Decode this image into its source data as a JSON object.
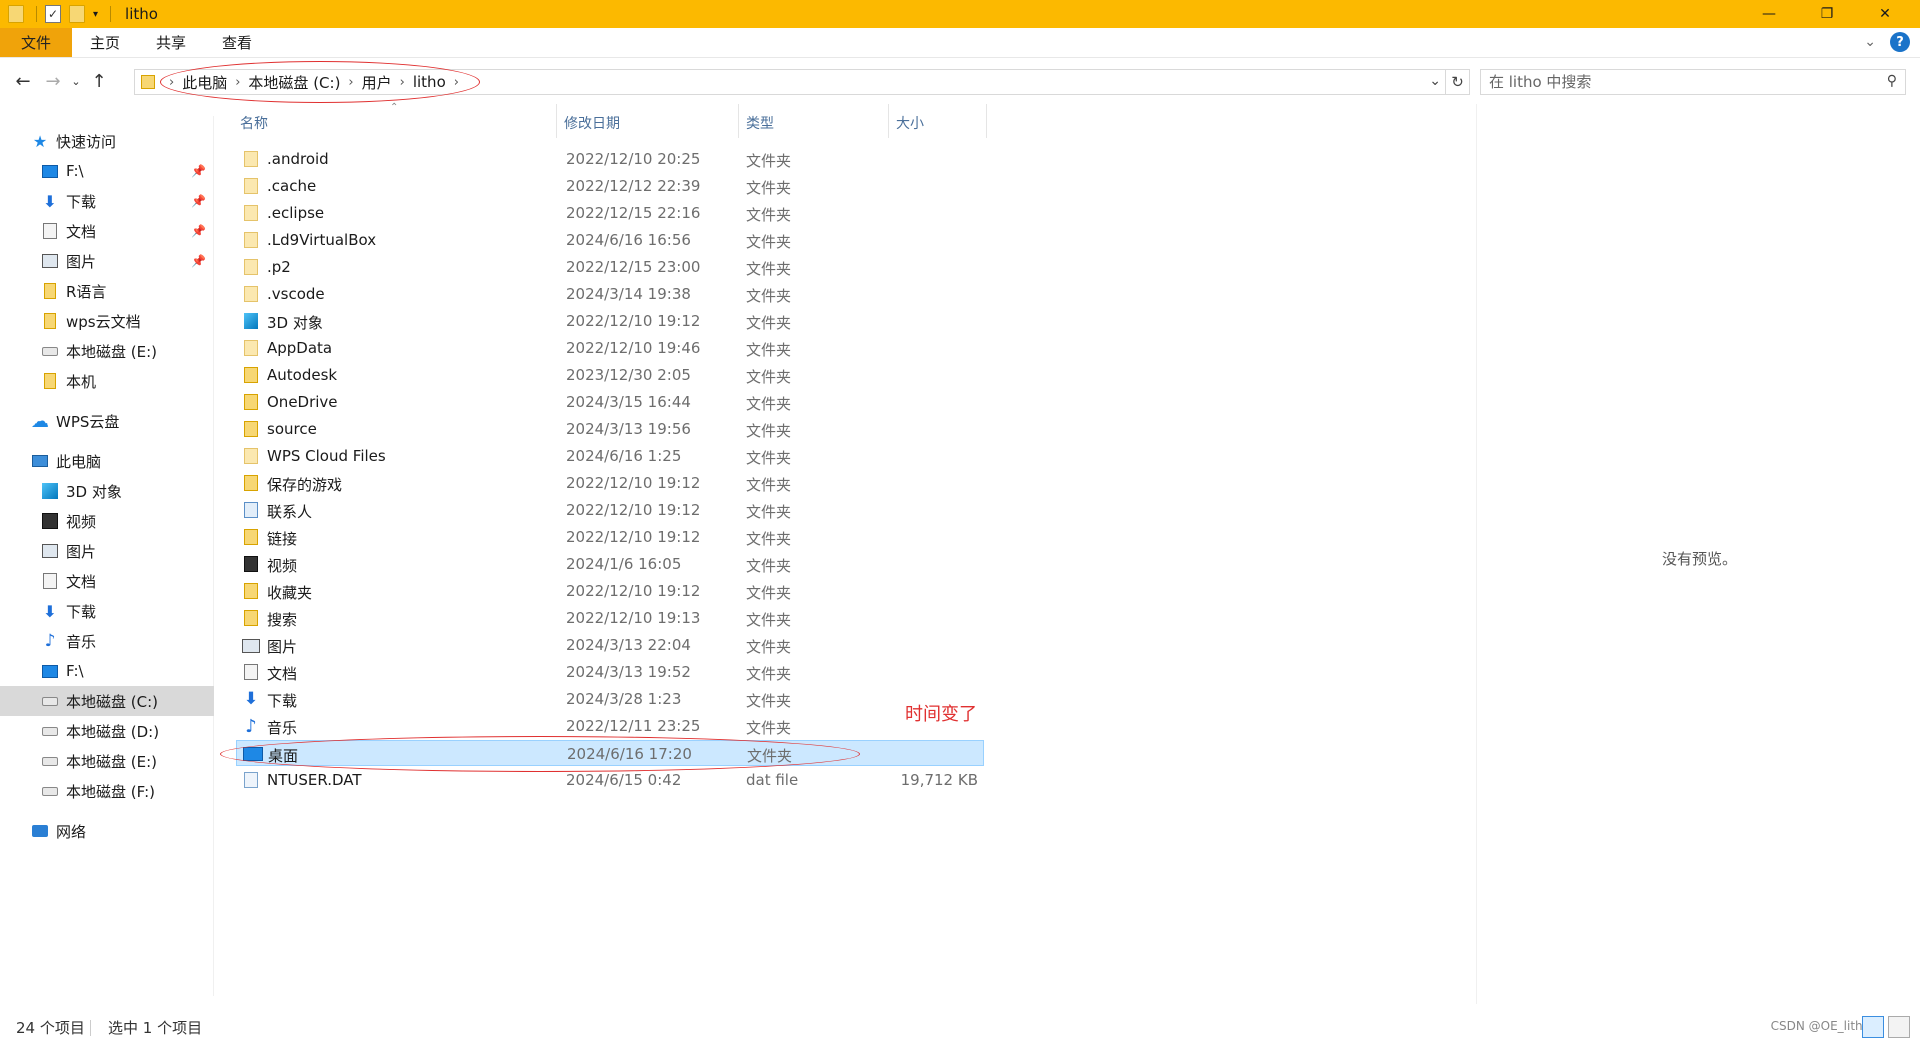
{
  "window": {
    "title": "litho",
    "ribbon_tabs": [
      "文件",
      "主页",
      "共享",
      "查看"
    ]
  },
  "address": {
    "crumbs": [
      "此电脑",
      "本地磁盘 (C:)",
      "用户",
      "litho"
    ],
    "search_placeholder": "在 litho 中搜索"
  },
  "sidebar": {
    "quick_access_label": "快速访问",
    "quick_access": [
      "F:\\",
      "下载",
      "文档",
      "图片",
      "R语言",
      "wps云文档",
      "本地磁盘 (E:)",
      "本机"
    ],
    "wps_label": "WPS云盘",
    "pc_label": "此电脑",
    "pc_items": [
      "3D 对象",
      "视频",
      "图片",
      "文档",
      "下载",
      "音乐",
      "F:\\",
      "本地磁盘 (C:)",
      "本地磁盘 (D:)",
      "本地磁盘 (E:)",
      "本地磁盘 (F:)"
    ],
    "network_label": "网络"
  },
  "columns": {
    "name": "名称",
    "date": "修改日期",
    "type": "类型",
    "size": "大小"
  },
  "files": [
    {
      "name": ".android",
      "date": "2022/12/10 20:25",
      "type": "文件夹",
      "size": "",
      "icon": "folder-hidden"
    },
    {
      "name": ".cache",
      "date": "2022/12/12 22:39",
      "type": "文件夹",
      "size": "",
      "icon": "folder-hidden"
    },
    {
      "name": ".eclipse",
      "date": "2022/12/15 22:16",
      "type": "文件夹",
      "size": "",
      "icon": "folder-hidden"
    },
    {
      "name": ".Ld9VirtualBox",
      "date": "2024/6/16 16:56",
      "type": "文件夹",
      "size": "",
      "icon": "folder-hidden"
    },
    {
      "name": ".p2",
      "date": "2022/12/15 23:00",
      "type": "文件夹",
      "size": "",
      "icon": "folder-hidden"
    },
    {
      "name": ".vscode",
      "date": "2024/3/14 19:38",
      "type": "文件夹",
      "size": "",
      "icon": "folder-hidden"
    },
    {
      "name": "3D 对象",
      "date": "2022/12/10 19:12",
      "type": "文件夹",
      "size": "",
      "icon": "3d"
    },
    {
      "name": "AppData",
      "date": "2022/12/10 19:46",
      "type": "文件夹",
      "size": "",
      "icon": "folder-hidden"
    },
    {
      "name": "Autodesk",
      "date": "2023/12/30 2:05",
      "type": "文件夹",
      "size": "",
      "icon": "folder"
    },
    {
      "name": "OneDrive",
      "date": "2024/3/15 16:44",
      "type": "文件夹",
      "size": "",
      "icon": "onedrive"
    },
    {
      "name": "source",
      "date": "2024/3/13 19:56",
      "type": "文件夹",
      "size": "",
      "icon": "folder"
    },
    {
      "name": "WPS Cloud Files",
      "date": "2024/6/16 1:25",
      "type": "文件夹",
      "size": "",
      "icon": "folder-hidden"
    },
    {
      "name": "保存的游戏",
      "date": "2022/12/10 19:12",
      "type": "文件夹",
      "size": "",
      "icon": "game"
    },
    {
      "name": "联系人",
      "date": "2022/12/10 19:12",
      "type": "文件夹",
      "size": "",
      "icon": "contact"
    },
    {
      "name": "链接",
      "date": "2022/12/10 19:12",
      "type": "文件夹",
      "size": "",
      "icon": "link"
    },
    {
      "name": "视频",
      "date": "2024/1/6 16:05",
      "type": "文件夹",
      "size": "",
      "icon": "video"
    },
    {
      "name": "收藏夹",
      "date": "2022/12/10 19:12",
      "type": "文件夹",
      "size": "",
      "icon": "folder"
    },
    {
      "name": "搜索",
      "date": "2022/12/10 19:13",
      "type": "文件夹",
      "size": "",
      "icon": "folder"
    },
    {
      "name": "图片",
      "date": "2024/3/13 22:04",
      "type": "文件夹",
      "size": "",
      "icon": "pictures"
    },
    {
      "name": "文档",
      "date": "2024/3/13 19:52",
      "type": "文件夹",
      "size": "",
      "icon": "documents"
    },
    {
      "name": "下载",
      "date": "2024/3/28 1:23",
      "type": "文件夹",
      "size": "",
      "icon": "download"
    },
    {
      "name": "音乐",
      "date": "2022/12/11 23:25",
      "type": "文件夹",
      "size": "",
      "icon": "music"
    },
    {
      "name": "桌面",
      "date": "2024/6/16 17:20",
      "type": "文件夹",
      "size": "",
      "icon": "desktop",
      "selected": true
    },
    {
      "name": "NTUSER.DAT",
      "date": "2024/6/15 0:42",
      "type": "dat file",
      "size": "19,712 KB",
      "icon": "dat"
    }
  ],
  "annotation": "时间变了",
  "preview": {
    "empty_text": "没有预览。"
  },
  "status": {
    "item_count": "24 个项目",
    "selected": "选中 1 个项目",
    "watermark": "CSDN @OE_litho"
  },
  "colors": {
    "titlebar": "#fcb900",
    "accent": "#1e88e5",
    "annotation": "#e03030",
    "selection": "#cce8ff"
  }
}
